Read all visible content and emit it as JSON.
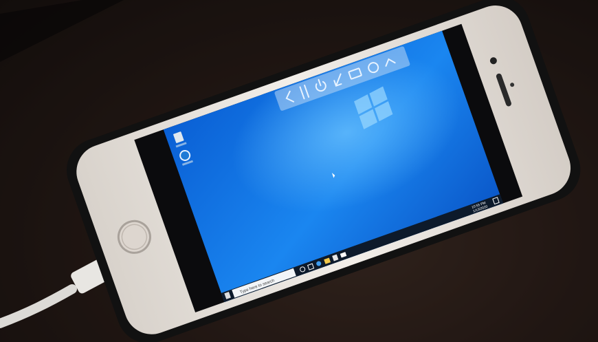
{
  "photo": {
    "subject": "phone-remote-desktop"
  },
  "remote_toolbar": {
    "buttons": [
      "back-icon",
      "pause-icon",
      "power-icon",
      "resize-icon",
      "keyboard-icon",
      "settings-icon",
      "collapse-icon"
    ]
  },
  "desktop": {
    "icons": [
      {
        "name": "recycle-bin-icon",
        "label": "Recycle Bin"
      },
      {
        "name": "edge-icon",
        "label": "Microsoft Edge"
      }
    ],
    "wallpaper": "windows-10-hero",
    "taskbar": {
      "search_placeholder": "Type here to search",
      "apps": [
        "cortana-icon",
        "task-view-icon",
        "edge-icon",
        "file-explorer-icon",
        "store-icon",
        "mail-icon"
      ],
      "clock": {
        "time": "10:55 PM",
        "date": "1/13/2020"
      }
    }
  },
  "colors": {
    "desktop_blue": "#0a6fe0",
    "desktop_light": "#3fa3ff",
    "phone_frame": "#e9e4df",
    "case": "#141414"
  }
}
